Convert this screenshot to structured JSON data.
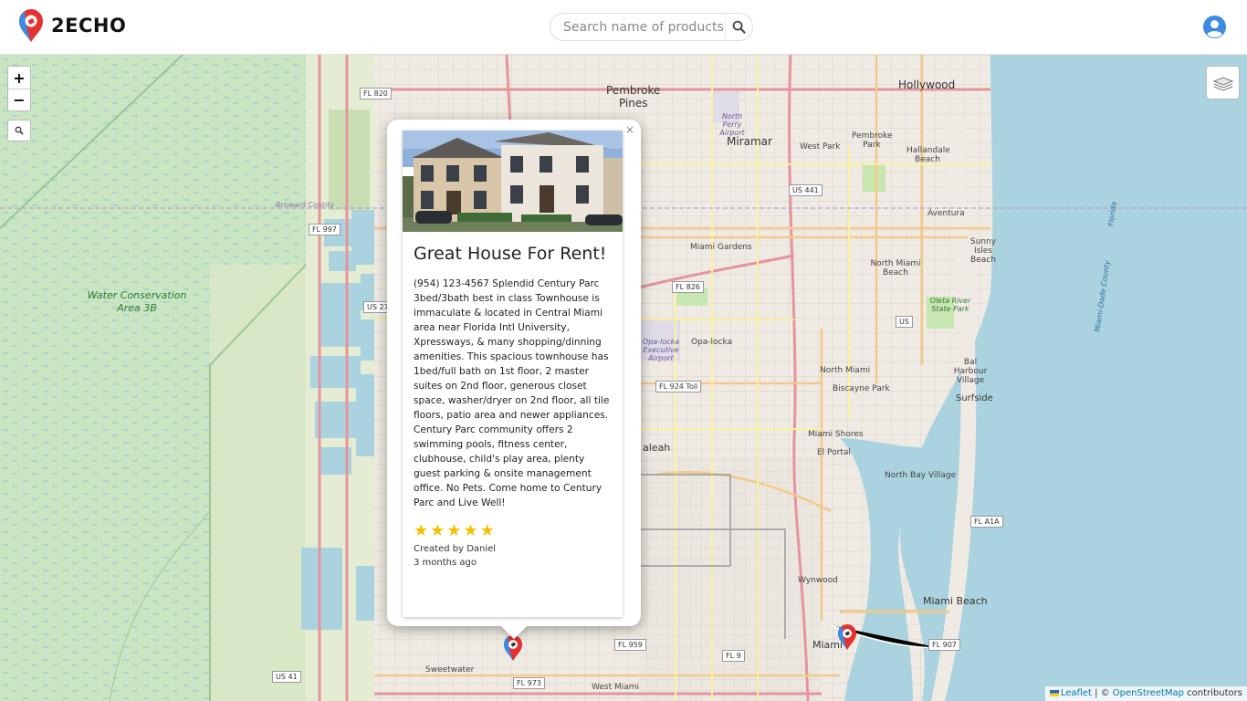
{
  "app": {
    "name": "2ECHO",
    "search_placeholder": "Search name of products, location..."
  },
  "icons": {
    "logo": "map-pin-logo-icon",
    "search": "search-icon",
    "user": "user-circle-icon",
    "layers": "layers-icon",
    "zoom_in": "plus-icon",
    "zoom_out": "minus-icon",
    "map_search": "magnifier-icon"
  },
  "colors": {
    "brand_red": "#e5312f",
    "brand_blue": "#3d8be0",
    "star": "#f2c200",
    "water": "#aad3df",
    "wetland": "#c9e5c2"
  },
  "map": {
    "zoom_in_label": "+",
    "zoom_out_label": "−",
    "attribution": {
      "leaflet": "Leaflet",
      "separator": " | © ",
      "osm": "OpenStreetMap",
      "contributors": " contributors"
    },
    "places": [
      {
        "label": "Pembroke\nPines"
      },
      {
        "label": "Hollywood"
      },
      {
        "label": "Miramar"
      },
      {
        "label": "West Park"
      },
      {
        "label": "Pembroke Park"
      },
      {
        "label": "Hallandale Beach"
      },
      {
        "label": "Aventura"
      },
      {
        "label": "Sunny Isles Beach"
      },
      {
        "label": "Miami Gardens"
      },
      {
        "label": "North Miami Beach"
      },
      {
        "label": "Opa-locka"
      },
      {
        "label": "North Miami"
      },
      {
        "label": "Biscayne Park"
      },
      {
        "label": "Bal Harbour Village"
      },
      {
        "label": "Surfside"
      },
      {
        "label": "Miami Shores"
      },
      {
        "label": "El Portal"
      },
      {
        "label": "North Bay Village"
      },
      {
        "label": "aleah"
      },
      {
        "label": "Wynwood"
      },
      {
        "label": "Miami Beach"
      },
      {
        "label": "Miami"
      },
      {
        "label": "Sweetwater"
      },
      {
        "label": "West Miami"
      },
      {
        "label": "Water Conservation Area 3B"
      },
      {
        "label": "Oleta River State Park"
      },
      {
        "label": "Opa-locka Executive Airport"
      },
      {
        "label": "North Perry Airport"
      },
      {
        "label": "Broward County"
      },
      {
        "label": "Miami-Dade County"
      },
      {
        "label": "Florida"
      }
    ],
    "shields": [
      "FL 820",
      "FL 997",
      "US 27",
      "FL 826",
      "FL 924 Toll",
      "US 441",
      "US",
      "FL A1A",
      "FL 907",
      "FL 959",
      "FL 9",
      "FL 973",
      "US 41"
    ]
  },
  "popup": {
    "close_label": "×",
    "title": "Great House For Rent!",
    "description": "(954) 123-4567 Splendid Century Parc 3bed/3bath best in class Townhouse is immaculate & located in Central Miami area near Florida Intl University, Xpressways, & many shopping/dinning amenities. This spacious townhouse has 1bed/full bath on 1st floor, 2 master suites on 2nd floor, generous closet space, washer/dryer on 2nd floor, all tile floors, patio area and newer appliances. Century Parc community offers 2 swimming pools, fitness center, clubhouse, child's play area, plenty guest parking & onsite management office. No Pets. Come home to Century Parc and Live Well!",
    "rating": 5,
    "rating_max": 5,
    "created_by": "Created by Daniel",
    "time_ago": "3 months ago"
  }
}
